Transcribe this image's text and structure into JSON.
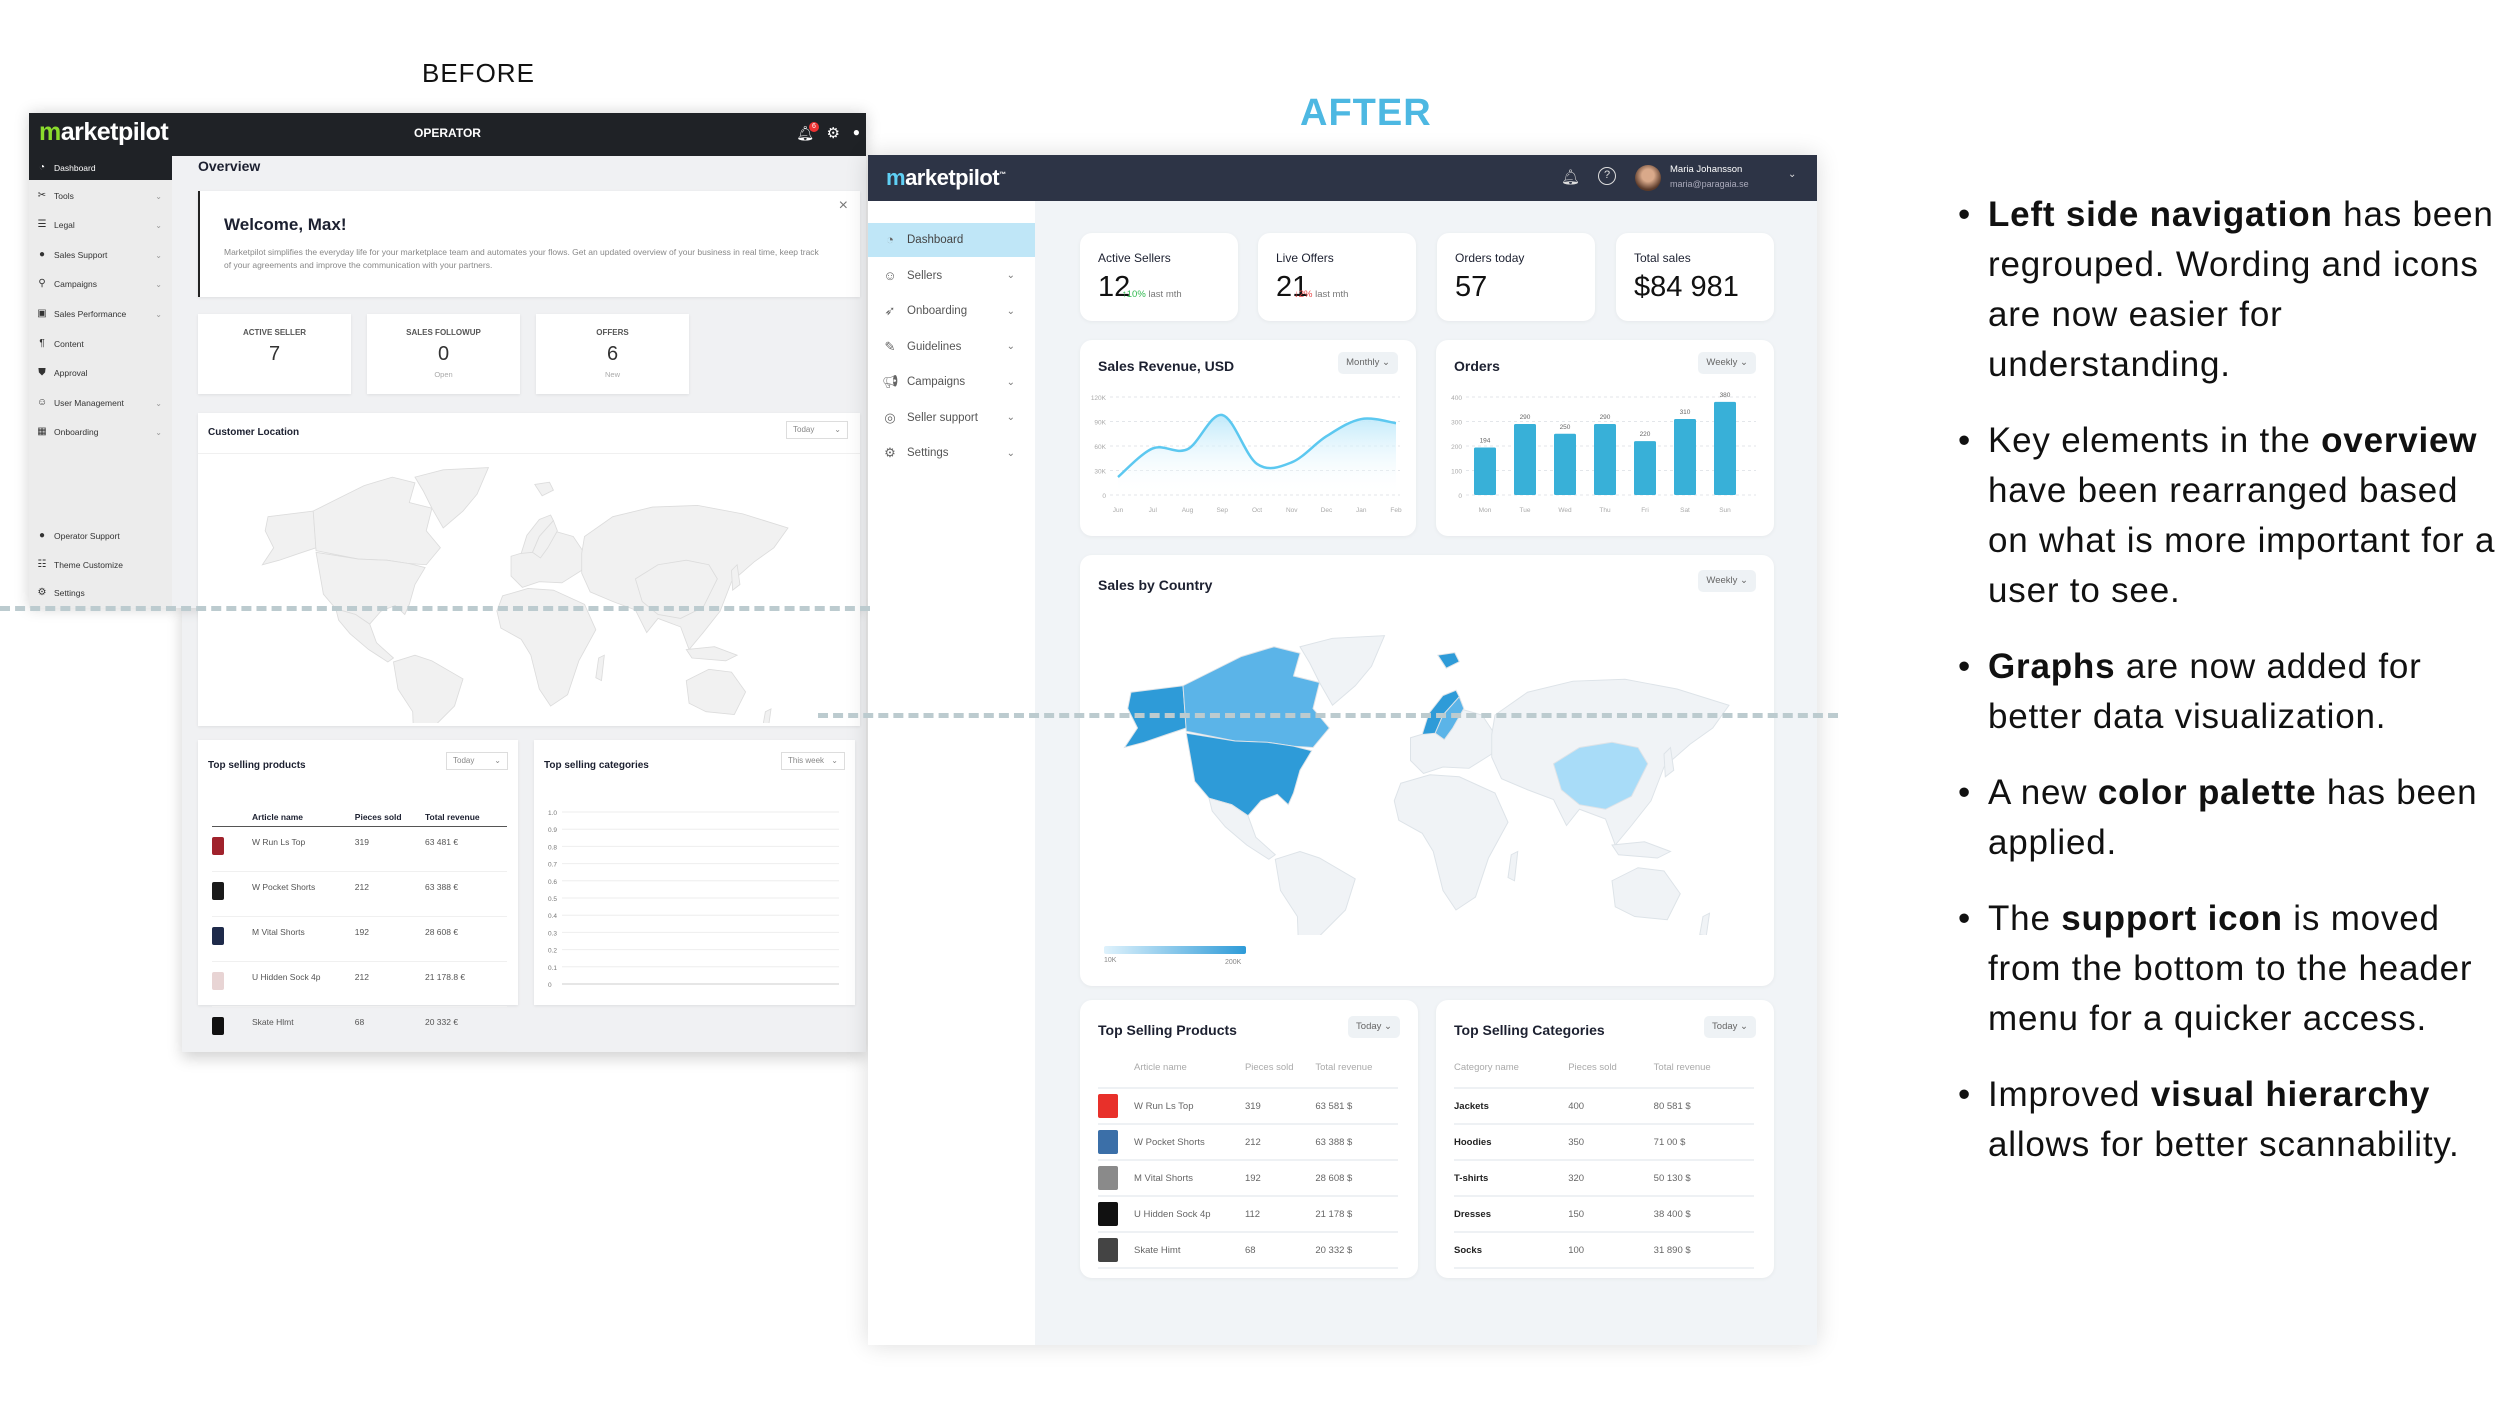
{
  "labels": {
    "before": "BEFORE",
    "after": "AFTER"
  },
  "before": {
    "logo": "marketpilot",
    "header_title": "OPERATOR",
    "notification_count": "6",
    "sidebar": [
      {
        "label": "Dashboard",
        "icon": "dashboard-icon",
        "active": true
      },
      {
        "label": "Tools",
        "icon": "tools-icon",
        "chev": true
      },
      {
        "label": "Legal",
        "icon": "legal-icon",
        "chev": true
      },
      {
        "label": "Sales Support",
        "icon": "chat-icon",
        "chev": true
      },
      {
        "label": "Campaigns",
        "icon": "joystick-icon",
        "chev": true
      },
      {
        "label": "Sales Performance",
        "icon": "performance-icon",
        "chev": true
      },
      {
        "label": "Content",
        "icon": "paragraph-icon"
      },
      {
        "label": "Approval",
        "icon": "shield-icon"
      },
      {
        "label": "User Management",
        "icon": "users-icon",
        "chev": true
      },
      {
        "label": "Onboarding",
        "icon": "calendar-icon",
        "chev": true
      }
    ],
    "sidebar_bottom": [
      {
        "label": "Operator Support",
        "icon": "chat-icon"
      },
      {
        "label": "Theme Customize",
        "icon": "theme-icon"
      },
      {
        "label": "Settings",
        "icon": "gear-icon"
      }
    ],
    "page_title": "Overview",
    "welcome": {
      "title": "Welcome, Max!",
      "text": "Marketpilot simplifies the everyday life for your marketplace team and automates your flows. Get an updated overview of your business in real time, keep track of your agreements and improve the communication with your partners."
    },
    "stats": [
      {
        "title": "ACTIVE SELLER",
        "value": "7",
        "sub": ""
      },
      {
        "title": "SALES FOLLOWUP",
        "value": "0",
        "sub": "Open"
      },
      {
        "title": "OFFERS",
        "value": "6",
        "sub": "New"
      }
    ],
    "customer_location": {
      "title": "Customer Location",
      "filter": "Today"
    },
    "top_products": {
      "title": "Top selling products",
      "filter": "Today",
      "columns": [
        "Article name",
        "Pieces sold",
        "Total revenue"
      ],
      "rows": [
        [
          "W Run Ls Top",
          "319",
          "63 481 €"
        ],
        [
          "W Pocket Shorts",
          "212",
          "63 388 €"
        ],
        [
          "M Vital Shorts",
          "192",
          "28 608 €"
        ],
        [
          "U Hidden Sock 4p",
          "212",
          "21 178.8 €"
        ],
        [
          "Skate Hlmt",
          "68",
          "20 332 €"
        ]
      ]
    },
    "top_categories": {
      "title": "Top selling categories",
      "filter": "This week",
      "yticks": [
        "1.0",
        "0.9",
        "0.8",
        "0.7",
        "0.6",
        "0.5",
        "0.4",
        "0.3",
        "0.2",
        "0.1",
        "0"
      ],
      "legend": "Top selling categories",
      "legend_color": "#1a8a2a"
    }
  },
  "after": {
    "logo": "marketpilot",
    "user": {
      "name": "Maria Johansson",
      "email": "maria@paragaia.se"
    },
    "sidebar": [
      {
        "label": "Dashboard",
        "icon": "dashboard-icon",
        "active": true
      },
      {
        "label": "Sellers",
        "icon": "users-icon",
        "chev": true
      },
      {
        "label": "Onboarding",
        "icon": "rocket-icon",
        "chev": true
      },
      {
        "label": "Guidelines",
        "icon": "edit-icon",
        "chev": true
      },
      {
        "label": "Campaigns",
        "icon": "megaphone-icon",
        "chev": true
      },
      {
        "label": "Seller support",
        "icon": "lifebuoy-icon",
        "chev": true
      },
      {
        "label": "Settings",
        "icon": "gear-icon",
        "chev": true
      }
    ],
    "kpis": [
      {
        "title": "Active Sellers",
        "value": "12",
        "delta": "10%",
        "delta_suffix": "last mth",
        "dir": "up"
      },
      {
        "title": "Live Offers",
        "value": "21",
        "delta": "2%",
        "delta_suffix": "last mth",
        "dir": "down"
      },
      {
        "title": "Orders today",
        "value": "57"
      },
      {
        "title": "Total sales",
        "value": "$84 981"
      }
    ],
    "colors": {
      "accent": "#38b0d8",
      "up": "#2fb84e",
      "down": "#e84545",
      "header": "#2d3446",
      "map_high": "#2e9bd8",
      "map_mid": "#5bb4e8",
      "map_low": "#a8dcf8"
    },
    "sales_by_country": {
      "title": "Sales by Country",
      "filter": "Weekly",
      "legend_min": "10K",
      "legend_max": "200K",
      "highlighted": [
        {
          "country": "United States",
          "level": "high"
        },
        {
          "country": "Alaska",
          "level": "high"
        },
        {
          "country": "Canada",
          "level": "mid"
        },
        {
          "country": "Norway",
          "level": "high"
        },
        {
          "country": "Sweden",
          "level": "mid"
        },
        {
          "country": "Svalbard",
          "level": "high"
        },
        {
          "country": "China",
          "level": "low"
        }
      ]
    },
    "top_products": {
      "title": "Top Selling Products",
      "filter": "Today",
      "columns": [
        "Article name",
        "Pieces sold",
        "Total  revenue"
      ],
      "rows": [
        [
          "W Run Ls Top",
          "319",
          "63 581 $"
        ],
        [
          "W Pocket Shorts",
          "212",
          "63 388 $"
        ],
        [
          "M Vital Shorts",
          "192",
          "28 608 $"
        ],
        [
          "U Hidden Sock 4p",
          "112",
          "21 178 $"
        ],
        [
          "Skate Himt",
          "68",
          "20 332 $"
        ]
      ]
    },
    "top_categories": {
      "title": "Top Selling Categories",
      "filter": "Today",
      "columns": [
        "Category name",
        "Pieces sold",
        "Total  revenue"
      ],
      "rows": [
        [
          "Jackets",
          "400",
          "80 581 $"
        ],
        [
          "Hoodies",
          "350",
          "71 00 $"
        ],
        [
          "T-shirts",
          "320",
          "50 130 $"
        ],
        [
          "Dresses",
          "150",
          "38 400 $"
        ],
        [
          "Socks",
          "100",
          "31 890 $"
        ]
      ]
    }
  },
  "chart_data": [
    {
      "type": "area",
      "title": "Sales Revenue, USD",
      "filter": "Monthly",
      "categories": [
        "Jun",
        "Jul",
        "Aug",
        "Sep",
        "Oct",
        "Nov",
        "Dec",
        "Jan",
        "Feb"
      ],
      "values": [
        22000,
        57000,
        56000,
        98000,
        38000,
        40000,
        72000,
        93000,
        88000
      ],
      "yticks": [
        "0",
        "30K",
        "60K",
        "90K",
        "120K"
      ],
      "ylim": [
        0,
        120000
      ],
      "grid": true,
      "color": "#5cc8f0"
    },
    {
      "type": "bar",
      "title": "Orders",
      "filter": "Weekly",
      "categories": [
        "Mon",
        "Tue",
        "Wed",
        "Thu",
        "Fri",
        "Sat",
        "Sun"
      ],
      "values": [
        194,
        290,
        250,
        290,
        220,
        310,
        380
      ],
      "yticks": [
        "0",
        "100",
        "200",
        "300",
        "400"
      ],
      "ylim": [
        0,
        400
      ],
      "grid": true,
      "color": "#38b0d8"
    }
  ],
  "bullets": [
    {
      "bold": "Left side navigation",
      "pre": "",
      "post": " has been regrouped. Wording and icons are now easier for understanding."
    },
    {
      "pre": "Key elements in the ",
      "bold": "overview",
      "post": " have been rearranged based on what is more important for a user to see."
    },
    {
      "pre": "",
      "bold": "Graphs",
      "post": " are now added for better data visualization."
    },
    {
      "pre": "A new ",
      "bold": "color palette",
      "post": " has been applied."
    },
    {
      "pre": "The ",
      "bold": "support icon",
      "post": " is moved from the bottom to the header menu for a quicker access."
    },
    {
      "pre": "Improved ",
      "bold": "visual hierarchy",
      "post": " allows for better scannability."
    }
  ]
}
